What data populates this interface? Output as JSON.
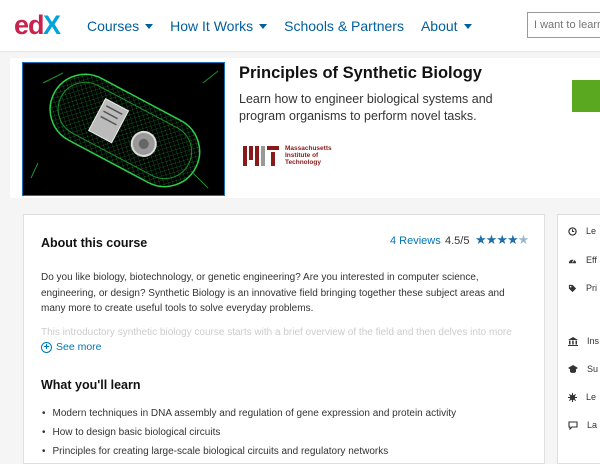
{
  "header": {
    "logo": {
      "text": "edX",
      "color_e": "#c8224f",
      "color_x": "#02a2dc"
    },
    "nav": [
      {
        "label": "Courses",
        "has_caret": true
      },
      {
        "label": "How It Works",
        "has_caret": true
      },
      {
        "label": "Schools & Partners",
        "has_caret": false
      },
      {
        "label": "About",
        "has_caret": true
      }
    ],
    "search_placeholder": "I want to learn ab"
  },
  "course": {
    "title": "Principles of Synthetic Biology",
    "subtitle": "Learn how to engineer biological systems and program organisms to perform novel tasks.",
    "school": {
      "line1": "Massachusetts",
      "line2": "Institute of",
      "line3": "Technology"
    },
    "enroll_button_color": "#5aa81f"
  },
  "about": {
    "title": "About this course",
    "reviews_label": "4 Reviews",
    "rating": "4.5/5",
    "stars": 4.5,
    "description": "Do you like biology, biotechnology, or genetic engineering? Are you interested in computer science, engineering, or design? Synthetic Biology is an innovative field bringing together these subject areas and many more to create useful tools to solve everyday problems.",
    "description_faded": "This introductory synthetic biology course starts with a brief overview of the field and then delves into more",
    "see_more": "See more"
  },
  "learn": {
    "title": "What you'll learn",
    "items": [
      "Modern techniques in DNA assembly and regulation of gene expression and protein activity",
      "How to design basic biological circuits",
      "Principles for creating large-scale biological circuits and regulatory networks"
    ]
  },
  "sidebar": {
    "items": [
      {
        "icon": "clock-icon",
        "label": "Le"
      },
      {
        "icon": "gauge-icon",
        "label": "Eff"
      },
      {
        "icon": "tag-icon",
        "label": "Pri"
      },
      {
        "icon": "institution-icon",
        "label": "Ins"
      },
      {
        "icon": "subject-icon",
        "label": "Su"
      },
      {
        "icon": "level-icon",
        "label": "Le"
      },
      {
        "icon": "language-icon",
        "label": "La"
      }
    ]
  },
  "colors": {
    "link": "#0075b4",
    "nav": "#00609c",
    "star": "#1f6ea8"
  }
}
